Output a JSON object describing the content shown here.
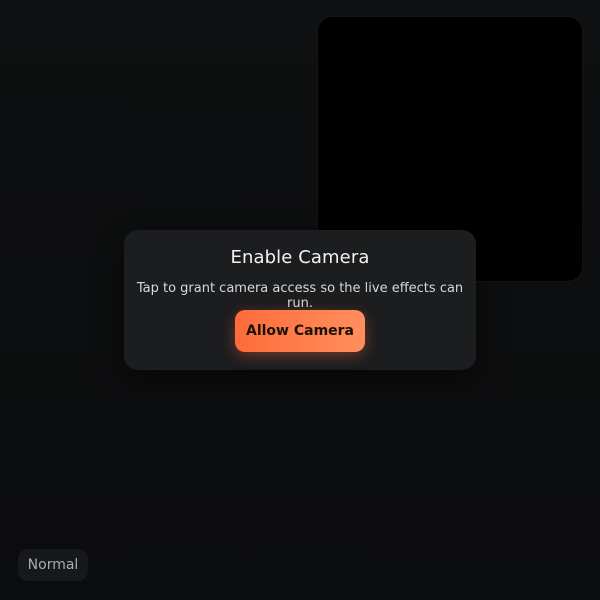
{
  "camera_prompt": {
    "title": "Enable Camera",
    "description": "Tap to grant camera access so the live effects can run.",
    "allow_label": "Allow Camera"
  },
  "mode": {
    "label": "Normal"
  },
  "colors": {
    "background": "#0d0e0f",
    "preview": "#000000",
    "accent_start": "#ff6b3a",
    "accent_end": "#ff8f5c"
  }
}
